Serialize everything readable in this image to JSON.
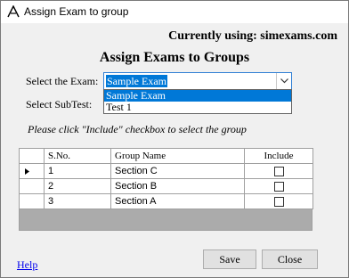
{
  "window": {
    "title": "Assign Exam to group"
  },
  "header": {
    "current_using": "Currently using: simexams.com",
    "heading": "Assign Exams to Groups"
  },
  "form": {
    "exam_label": "Select the Exam:",
    "subtest_label": "Select SubTest:",
    "exam_value": "Sample Exam",
    "exam_options": [
      "Sample Exam",
      "Test 1"
    ],
    "instruction": "Please click \"Include\" checkbox to select the group"
  },
  "grid": {
    "columns": [
      "S.No.",
      "Group Name",
      "Include"
    ],
    "rows": [
      {
        "sno": "1",
        "name": "Section C",
        "include": false
      },
      {
        "sno": "2",
        "name": "Section B",
        "include": false
      },
      {
        "sno": "3",
        "name": "Section A",
        "include": false
      }
    ]
  },
  "footer": {
    "help": "Help",
    "save": "Save",
    "close": "Close"
  }
}
